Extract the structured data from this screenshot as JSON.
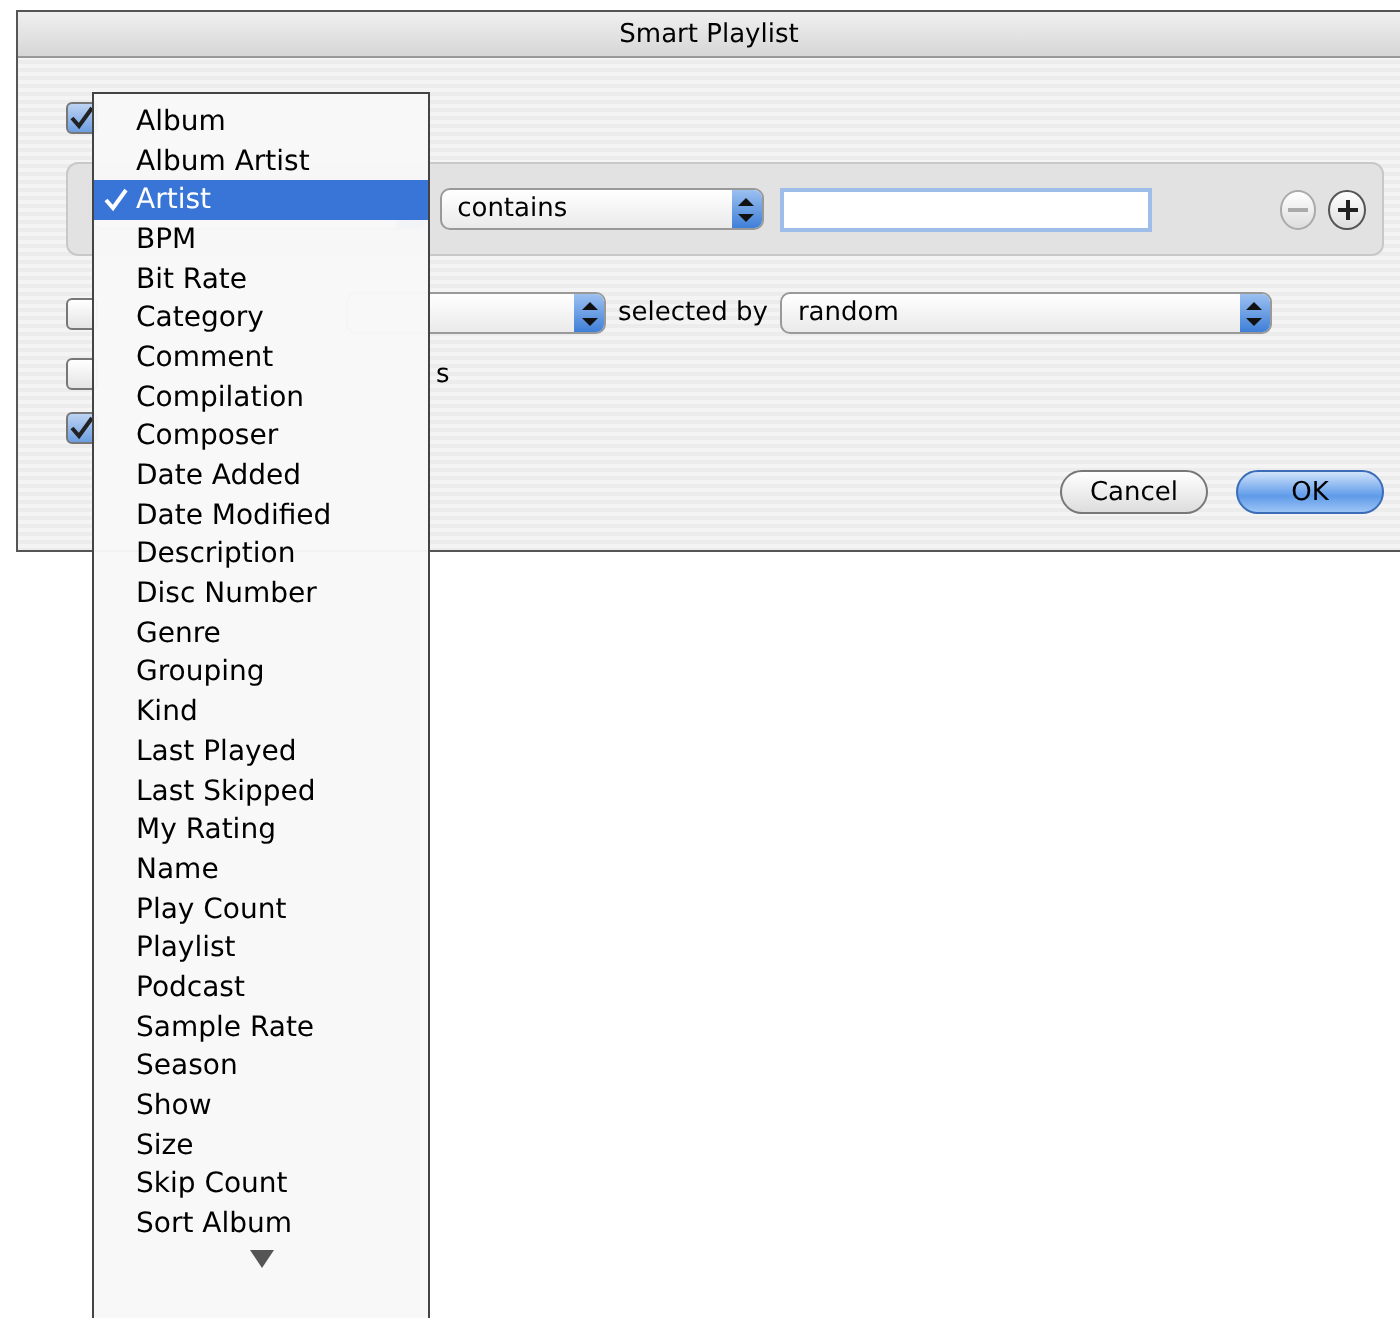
{
  "window": {
    "title": "Smart Playlist"
  },
  "match_rule": {
    "checked": true
  },
  "rule": {
    "operator": "contains",
    "remove_disabled": true
  },
  "limit": {
    "checked": false
  },
  "selection": {
    "label": "selected by",
    "value": "random"
  },
  "checked_only": {
    "checked": false,
    "label": "s"
  },
  "live_updating": {
    "checked": true
  },
  "buttons": [
    {
      "label": "Cancel",
      "default": false
    },
    {
      "label": "OK",
      "default": true
    }
  ],
  "menu": {
    "more_below": true,
    "items": [
      {
        "label": "Album",
        "selected": false
      },
      {
        "label": "Album Artist",
        "selected": false
      },
      {
        "label": "Artist",
        "selected": true
      },
      {
        "label": "BPM",
        "selected": false
      },
      {
        "label": "Bit Rate",
        "selected": false
      },
      {
        "label": "Category",
        "selected": false
      },
      {
        "label": "Comment",
        "selected": false
      },
      {
        "label": "Compilation",
        "selected": false
      },
      {
        "label": "Composer",
        "selected": false
      },
      {
        "label": "Date Added",
        "selected": false
      },
      {
        "label": "Date Modified",
        "selected": false
      },
      {
        "label": "Description",
        "selected": false
      },
      {
        "label": "Disc Number",
        "selected": false
      },
      {
        "label": "Genre",
        "selected": false
      },
      {
        "label": "Grouping",
        "selected": false
      },
      {
        "label": "Kind",
        "selected": false
      },
      {
        "label": "Last Played",
        "selected": false
      },
      {
        "label": "Last Skipped",
        "selected": false
      },
      {
        "label": "My Rating",
        "selected": false
      },
      {
        "label": "Name",
        "selected": false
      },
      {
        "label": "Play Count",
        "selected": false
      },
      {
        "label": "Playlist",
        "selected": false
      },
      {
        "label": "Podcast",
        "selected": false
      },
      {
        "label": "Sample Rate",
        "selected": false
      },
      {
        "label": "Season",
        "selected": false
      },
      {
        "label": "Show",
        "selected": false
      },
      {
        "label": "Size",
        "selected": false
      },
      {
        "label": "Skip Count",
        "selected": false
      },
      {
        "label": "Sort Album",
        "selected": false
      }
    ]
  }
}
